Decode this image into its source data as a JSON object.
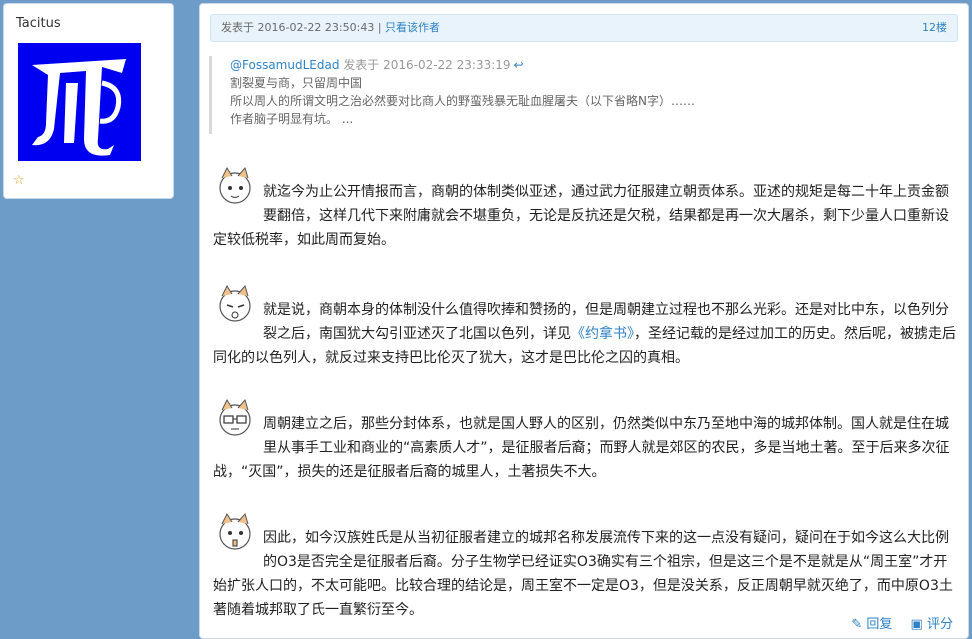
{
  "user": {
    "name": "Tacitus"
  },
  "post": {
    "posted_at": "发表于 2016-02-22 23:50:43",
    "separator": " | ",
    "only_author": "只看该作者",
    "floor": "12楼",
    "quote": {
      "author": "@FossamudLEdad",
      "posted_at": " 发表于 2016-02-22 23:33:19",
      "lines": [
        "割裂夏与商，只留周中国",
        "所以周人的所谓文明之治必然要对比商人的野蛮残暴无耻血腥屠夫（以下省略N字）……",
        "作者脑子明显有坑。 ..."
      ]
    },
    "paragraphs": [
      {
        "text": "就迄今为止公开情报而言，商朝的体制类似亚述，通过武力征服建立朝贡体系。亚述的规矩是每二十年上贡金额要翻倍，这样几代下来附庸就会不堪重负，无论是反抗还是欠税，结果都是再一次大屠杀，剩下少量人口重新设定较低税率，如此周而复始。"
      },
      {
        "before": "就是说，商朝本身的体制没什么值得吹捧和赞扬的，但是周朝建立过程也不那么光彩。还是对比中东，以色列分裂之后，南国犹大勾引亚述灭了北国以色列，详见",
        "book": "《约拿书》",
        "after": "，圣经记载的是经过加工的历史。然后呢，被掳走后同化的以色列人，就反过来支持巴比伦灭了犹大，这才是巴比伦之囚的真相。"
      },
      {
        "text": "周朝建立之后，那些分封体系，也就是国人野人的区别，仍然类似中东乃至地中海的城邦体制。国人就是住在城里从事手工业和商业的“高素质人才”，是征服者后裔；而野人就是郊区的农民，多是当地土著。至于后来多次征战，“灭国”，损失的还是征服者后裔的城里人，土著损失不大。"
      },
      {
        "text": "因此，如今汉族姓氏是从当初征服者建立的城邦名称发展流传下来的这一点没有疑问，疑问在于如今这么大比例的O3是否完全是征服者后裔。分子生物学已经证实O3确实有三个祖宗，但是这三个是不是就是从“周王室”才开始扩张人口的，不太可能吧。比较合理的结论是，周王室不一定是O3，但是没关系，反正周朝早就灭绝了，而中原O3土著随着城邦取了氏一直繁衍至今。"
      }
    ],
    "actions": {
      "reply": "回复",
      "rate": "评分"
    }
  },
  "colors": {
    "page_bg": "#6d9cc8",
    "link": "#2f82c5",
    "avatar_bg": "#0000f0",
    "header_bg": "#e8f3fb"
  },
  "icons": [
    "star-icon",
    "reply-arrow-icon",
    "pencil-icon",
    "rate-icon",
    "emoticon"
  ]
}
